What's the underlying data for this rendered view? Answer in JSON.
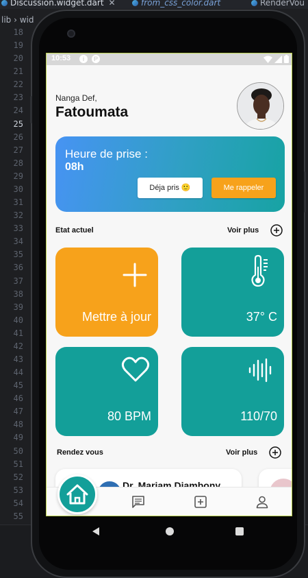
{
  "ide": {
    "tabs": [
      {
        "label": "Discussion.widget.dart",
        "close": "✕"
      },
      {
        "label": "from_css_color.dart"
      },
      {
        "label": "RenderVou"
      }
    ],
    "breadcrumb": "lib › wid",
    "line_numbers": [
      "18",
      "19",
      "20",
      "21",
      "22",
      "23",
      "24",
      "25",
      "26",
      "27",
      "28",
      "29",
      "30",
      "31",
      "32",
      "33",
      "34",
      "35",
      "36",
      "37",
      "38",
      "39",
      "40",
      "41",
      "42",
      "43",
      "44",
      "45",
      "46",
      "47",
      "48",
      "49",
      "50",
      "51",
      "52",
      "53",
      "54",
      "55"
    ],
    "current_line": "25"
  },
  "status_bar": {
    "time": "10:53",
    "icons": [
      "info-icon",
      "data-saver-icon",
      "wifi-icon",
      "signal-icon",
      "battery-icon"
    ]
  },
  "header": {
    "greeting": "Nanga Def,",
    "user_name": "Fatoumata"
  },
  "reminder": {
    "title": "Heure de prise :",
    "time": "08h",
    "taken_label": "Déja pris 🙂",
    "remind_label": "Me rappeler"
  },
  "status_section": {
    "title": "Etat actuel",
    "more_label": "Voir plus",
    "tiles": [
      {
        "icon": "plus-icon",
        "label": "Mettre à jour",
        "color": "#f7a21b"
      },
      {
        "icon": "thermometer-icon",
        "label": "37° C",
        "color": "#139f99"
      },
      {
        "icon": "heart-icon",
        "label": "80 BPM",
        "color": "#139f99"
      },
      {
        "icon": "waveform-icon",
        "label": "110/70",
        "color": "#139f99"
      }
    ]
  },
  "appointments": {
    "title": "Rendez vous",
    "more_label": "Voir plus",
    "cards": [
      {
        "doctor": "Dr. Mariam Diambony"
      }
    ]
  },
  "bottom_nav": {
    "items": [
      "home-icon",
      "chat-icon",
      "add-box-icon",
      "person-icon"
    ],
    "active": "home-icon"
  },
  "colors": {
    "accent_teal": "#139f99",
    "accent_orange": "#f7a21b",
    "banner_start": "#4793f3"
  }
}
